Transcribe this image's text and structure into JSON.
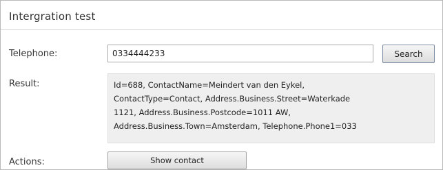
{
  "title": "Intergration test",
  "telephone": {
    "label": "Telephone:",
    "value": "0334444233"
  },
  "search_button": "Search",
  "result": {
    "label": "Result:",
    "text": "Id=688, ContactName=Meindert van den Eykel,\nContactType=Contact, Address.Business.Street=Waterkade\n1121, Address.Business.Postcode=1011 AW,\nAddress.Business.Town=Amsterdam, Telephone.Phone1=033"
  },
  "actions": {
    "label": "Actions:",
    "show_contact_button": "Show contact"
  }
}
